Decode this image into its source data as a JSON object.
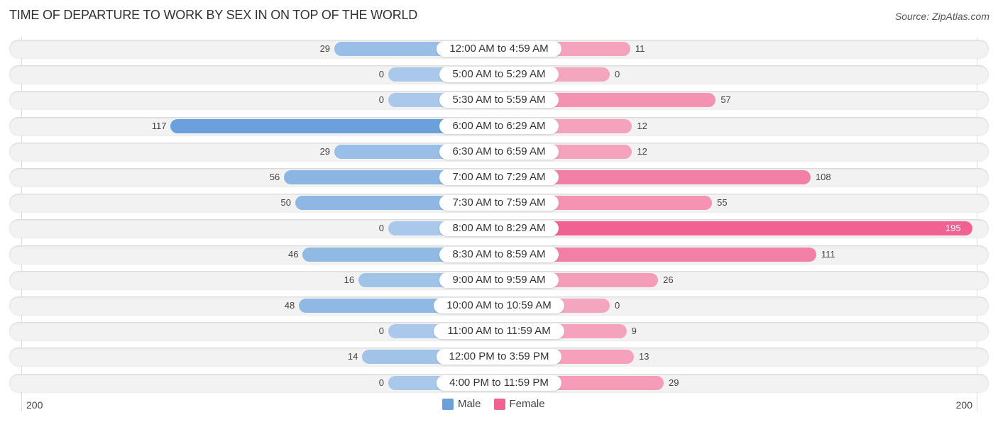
{
  "title": "TIME OF DEPARTURE TO WORK BY SEX IN ON TOP OF THE WORLD",
  "source": "Source: ZipAtlas.com",
  "colors": {
    "male": "#6aa1dc",
    "male_light": "#a9c8ea",
    "female": "#f06292",
    "female_light": "#f5a6bf"
  },
  "chart_data": {
    "type": "bar",
    "orientation": "horizontal-diverging",
    "title": "TIME OF DEPARTURE TO WORK BY SEX IN ON TOP OF THE WORLD",
    "categories": [
      "12:00 AM to 4:59 AM",
      "5:00 AM to 5:29 AM",
      "5:30 AM to 5:59 AM",
      "6:00 AM to 6:29 AM",
      "6:30 AM to 6:59 AM",
      "7:00 AM to 7:29 AM",
      "7:30 AM to 7:59 AM",
      "8:00 AM to 8:29 AM",
      "8:30 AM to 8:59 AM",
      "9:00 AM to 9:59 AM",
      "10:00 AM to 10:59 AM",
      "11:00 AM to 11:59 AM",
      "12:00 PM to 3:59 PM",
      "4:00 PM to 11:59 PM"
    ],
    "series": [
      {
        "name": "Male",
        "values": [
          29,
          0,
          0,
          117,
          29,
          56,
          50,
          0,
          46,
          16,
          48,
          0,
          14,
          0
        ]
      },
      {
        "name": "Female",
        "values": [
          11,
          0,
          57,
          12,
          12,
          108,
          55,
          195,
          111,
          26,
          0,
          9,
          13,
          29
        ]
      }
    ],
    "axis": {
      "left_label": "200",
      "right_label": "200",
      "range": [
        0,
        200
      ]
    },
    "legend": {
      "position": "bottom-center",
      "entries": [
        "Male",
        "Female"
      ]
    }
  }
}
